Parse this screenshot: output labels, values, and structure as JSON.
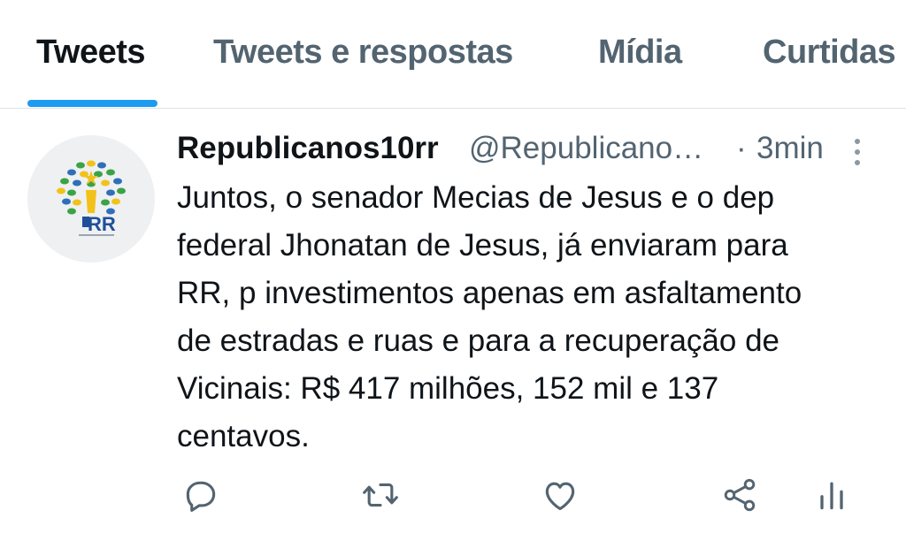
{
  "tabs": [
    {
      "label": "Tweets",
      "active": true
    },
    {
      "label": "Tweets e respostas",
      "active": false
    },
    {
      "label": "Mídia",
      "active": false
    },
    {
      "label": "Curtidas",
      "active": false
    }
  ],
  "tweet": {
    "author_name": "Republicanos10rr",
    "author_handle": "@Republicano…",
    "separator": "·",
    "time": "3min",
    "avatar_text": "RR",
    "text_lines": [
      "Juntos, o senador Mecias de Jesus e o dep",
      "federal Jhonatan de Jesus, já enviaram para",
      "RR, p investimentos apenas em asfaltamento",
      "de estradas e ruas e para a recuperação de",
      "Vicinais: R$ 417 milhões, 152 mil e 137",
      "centavos."
    ]
  },
  "actions": [
    {
      "icon": "reply-icon"
    },
    {
      "icon": "retweet-icon"
    },
    {
      "icon": "like-icon"
    },
    {
      "icon": "share-icon"
    },
    {
      "icon": "analytics-icon"
    }
  ],
  "colors": {
    "accent": "#1d9bf0",
    "text_primary": "#0f1419",
    "text_secondary": "#536471"
  }
}
